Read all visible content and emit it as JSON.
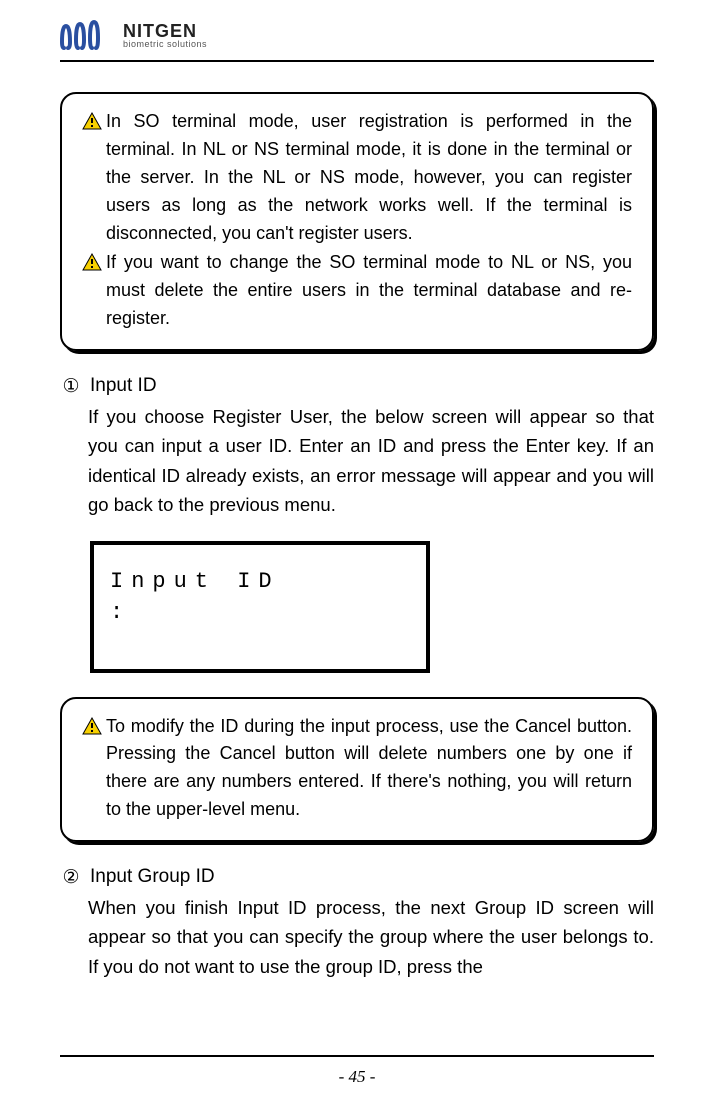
{
  "logo": {
    "brand": "NITGEN",
    "tagline": "biometric solutions"
  },
  "callout1": {
    "items": [
      "In SO terminal mode, user registration is performed in the terminal. In NL or NS terminal mode, it is done in the terminal or the server. In the NL or NS mode, however, you can register users as long as the network works well. If the terminal is disconnected, you can't register users.",
      "If you want to change the SO terminal mode to NL or NS, you must delete the entire users in the terminal database and re-register."
    ]
  },
  "section1": {
    "num": "①",
    "title": "Input ID",
    "body": "If you choose Register User, the below screen will appear so that you can input a user ID. Enter an ID and press the Enter key. If an identical ID already exists, an error message will appear and you will go back to the previous menu."
  },
  "lcd": {
    "line1": "Input ID",
    "line2": ":"
  },
  "callout2": {
    "items": [
      "To modify the ID during the input process, use the Cancel button. Pressing the Cancel button will delete numbers one by one if there are any numbers entered. If there's nothing, you will return to the upper-level menu."
    ]
  },
  "section2": {
    "num": "②",
    "title": "Input Group ID",
    "body": "When you finish Input ID process, the next Group ID screen will appear so that you can specify the group where the user belongs to. If you do not want to use the group ID, press the"
  },
  "page_number": "- 45 -"
}
